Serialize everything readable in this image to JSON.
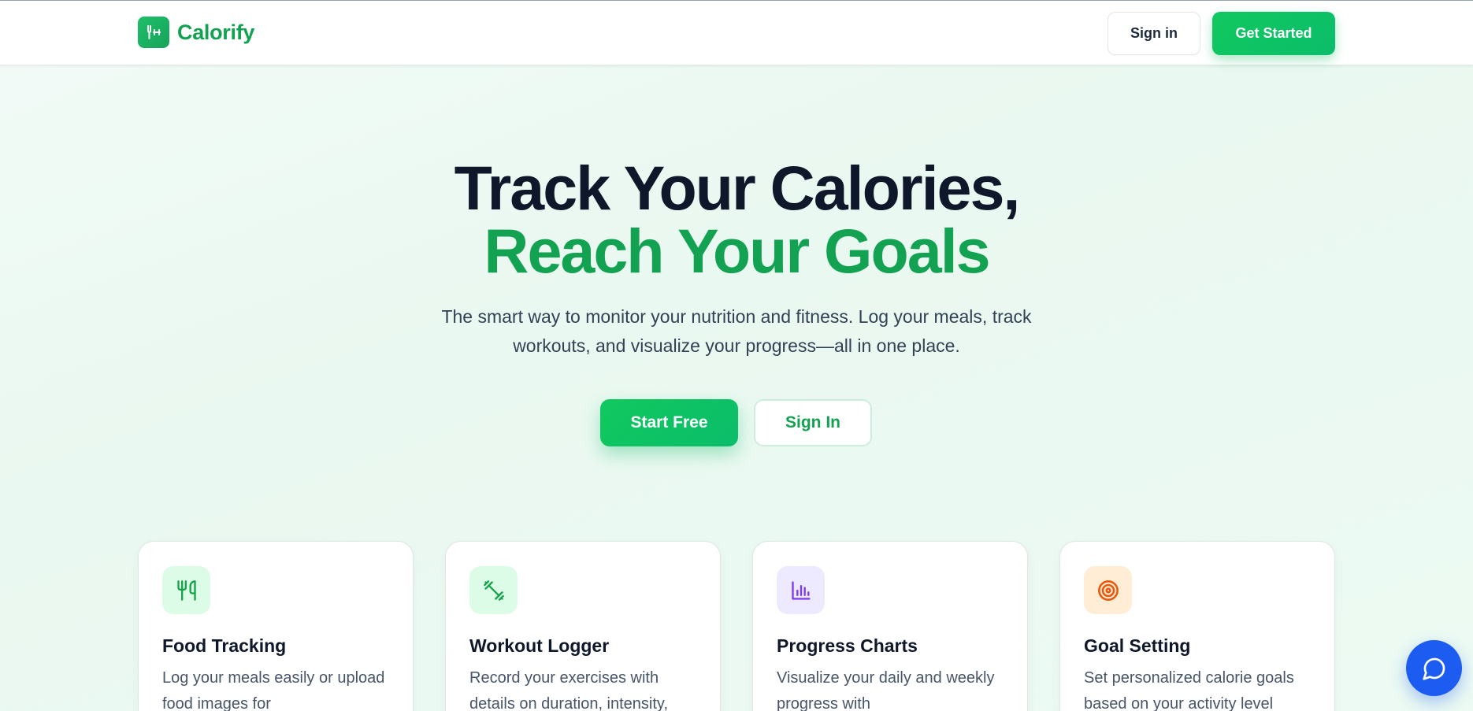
{
  "header": {
    "brand": "Calorify",
    "brand_icon": "fork-dumbbell-icon",
    "signin_label": "Sign in",
    "cta_label": "Get Started"
  },
  "hero": {
    "title_line1": "Track Your Calories,",
    "title_line2": "Reach Your Goals",
    "subtitle": "The smart way to monitor your nutrition and fitness. Log your meals, track workouts, and visualize your progress—all in one place.",
    "primary_cta": "Start Free",
    "secondary_cta": "Sign In"
  },
  "features": [
    {
      "title": "Food Tracking",
      "desc": "Log your meals easily or upload food images for",
      "icon": "utensils-icon",
      "icon_color": "#16a34a",
      "icon_bg": "#dcfce7"
    },
    {
      "title": "Workout Logger",
      "desc": "Record your exercises with details on duration, intensity,",
      "icon": "dumbbell-icon",
      "icon_color": "#16a34a",
      "icon_bg": "#dcfce7"
    },
    {
      "title": "Progress Charts",
      "desc": "Visualize your daily and weekly progress with",
      "icon": "bar-chart-icon",
      "icon_color": "#7c3aed",
      "icon_bg": "#ede9fe"
    },
    {
      "title": "Goal Setting",
      "desc": "Set personalized calorie goals based on your activity level",
      "icon": "target-icon",
      "icon_color": "#ea580c",
      "icon_bg": "#ffedd5"
    }
  ],
  "chat": {
    "icon": "chat-bubble-icon"
  },
  "colors": {
    "accent": "#13a152",
    "accent_bright": "#10c85f",
    "chat": "#1c5cf0"
  }
}
